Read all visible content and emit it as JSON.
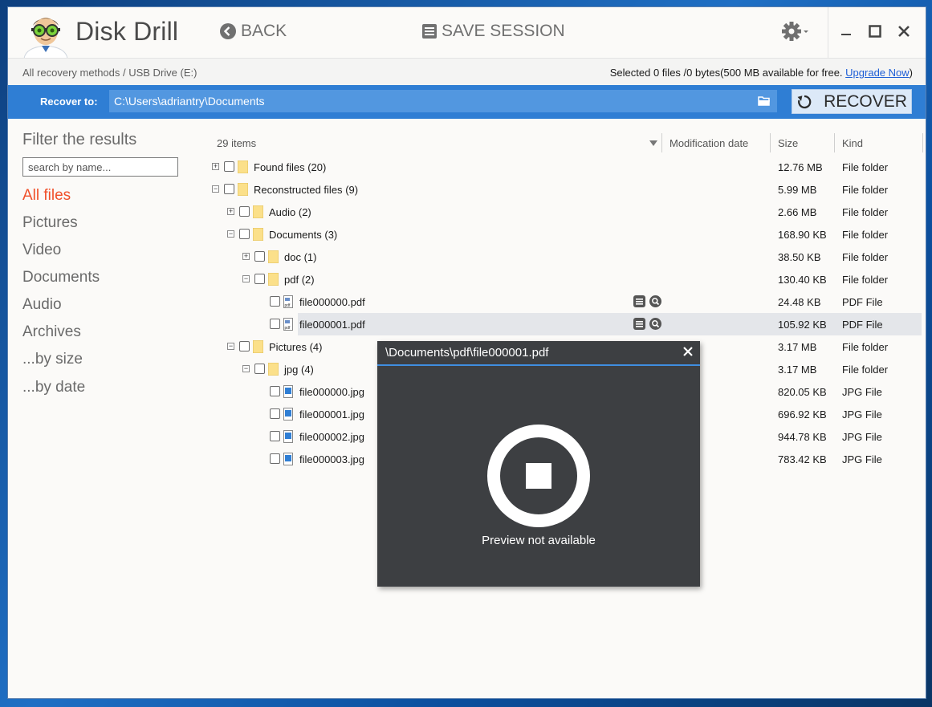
{
  "app": {
    "title": "Disk Drill"
  },
  "toolbar": {
    "back_label": "BACK",
    "save_label": "SAVE SESSION"
  },
  "breadcrumb": "All recovery methods / USB Drive (E:)",
  "selection": {
    "text": "Selected 0 files /0 bytes(500 MB available for free.",
    "upgrade_label": "Upgrade Now",
    "suffix": ")"
  },
  "recover": {
    "label": "Recover to:",
    "path": "C:\\Users\\adriantry\\Documents",
    "button_label": "RECOVER"
  },
  "sidebar": {
    "title": "Filter the results",
    "search_placeholder": "search by name...",
    "categories": [
      "All files",
      "Pictures",
      "Video",
      "Documents",
      "Audio",
      "Archives",
      "...by size",
      "...by date"
    ],
    "active": "All files"
  },
  "table": {
    "count": "29 items",
    "headers": {
      "date": "Modification date",
      "size": "Size",
      "kind": "Kind"
    },
    "rows": [
      {
        "name": "Found files",
        "count": "(20)",
        "size": "12.76 MB",
        "kind": "File folder"
      },
      {
        "name": "Reconstructed files",
        "count": "(9)",
        "size": "5.99 MB",
        "kind": "File folder"
      },
      {
        "name": "Audio",
        "count": "(2)",
        "size": "2.66 MB",
        "kind": "File folder"
      },
      {
        "name": "Documents",
        "count": "(3)",
        "size": "168.90 KB",
        "kind": "File folder"
      },
      {
        "name": "doc",
        "count": "(1)",
        "size": "38.50 KB",
        "kind": "File folder"
      },
      {
        "name": "pdf",
        "count": "(2)",
        "size": "130.40 KB",
        "kind": "File folder"
      },
      {
        "name": "file000000.pdf",
        "count": "",
        "size": "24.48 KB",
        "kind": "PDF File"
      },
      {
        "name": "file000001.pdf",
        "count": "",
        "size": "105.92 KB",
        "kind": "PDF File"
      },
      {
        "name": "Pictures",
        "count": "(4)",
        "size": "3.17 MB",
        "kind": "File folder"
      },
      {
        "name": "jpg",
        "count": "(4)",
        "size": "3.17 MB",
        "kind": "File folder"
      },
      {
        "name": "file000000.jpg",
        "count": "",
        "size": "820.05 KB",
        "kind": "JPG File"
      },
      {
        "name": "file000001.jpg",
        "count": "",
        "size": "696.92 KB",
        "kind": "JPG File"
      },
      {
        "name": "file000002.jpg",
        "count": "",
        "size": "944.78 KB",
        "kind": "JPG File"
      },
      {
        "name": "file000003.jpg",
        "count": "",
        "size": "783.42 KB",
        "kind": "JPG File"
      }
    ]
  },
  "preview": {
    "title": "\\Documents\\pdf\\file000001.pdf",
    "message": "Preview not available"
  },
  "colors": {
    "accent": "#2f7ed4",
    "active_category": "#f0502a",
    "preview_bg": "#3d3f42"
  }
}
